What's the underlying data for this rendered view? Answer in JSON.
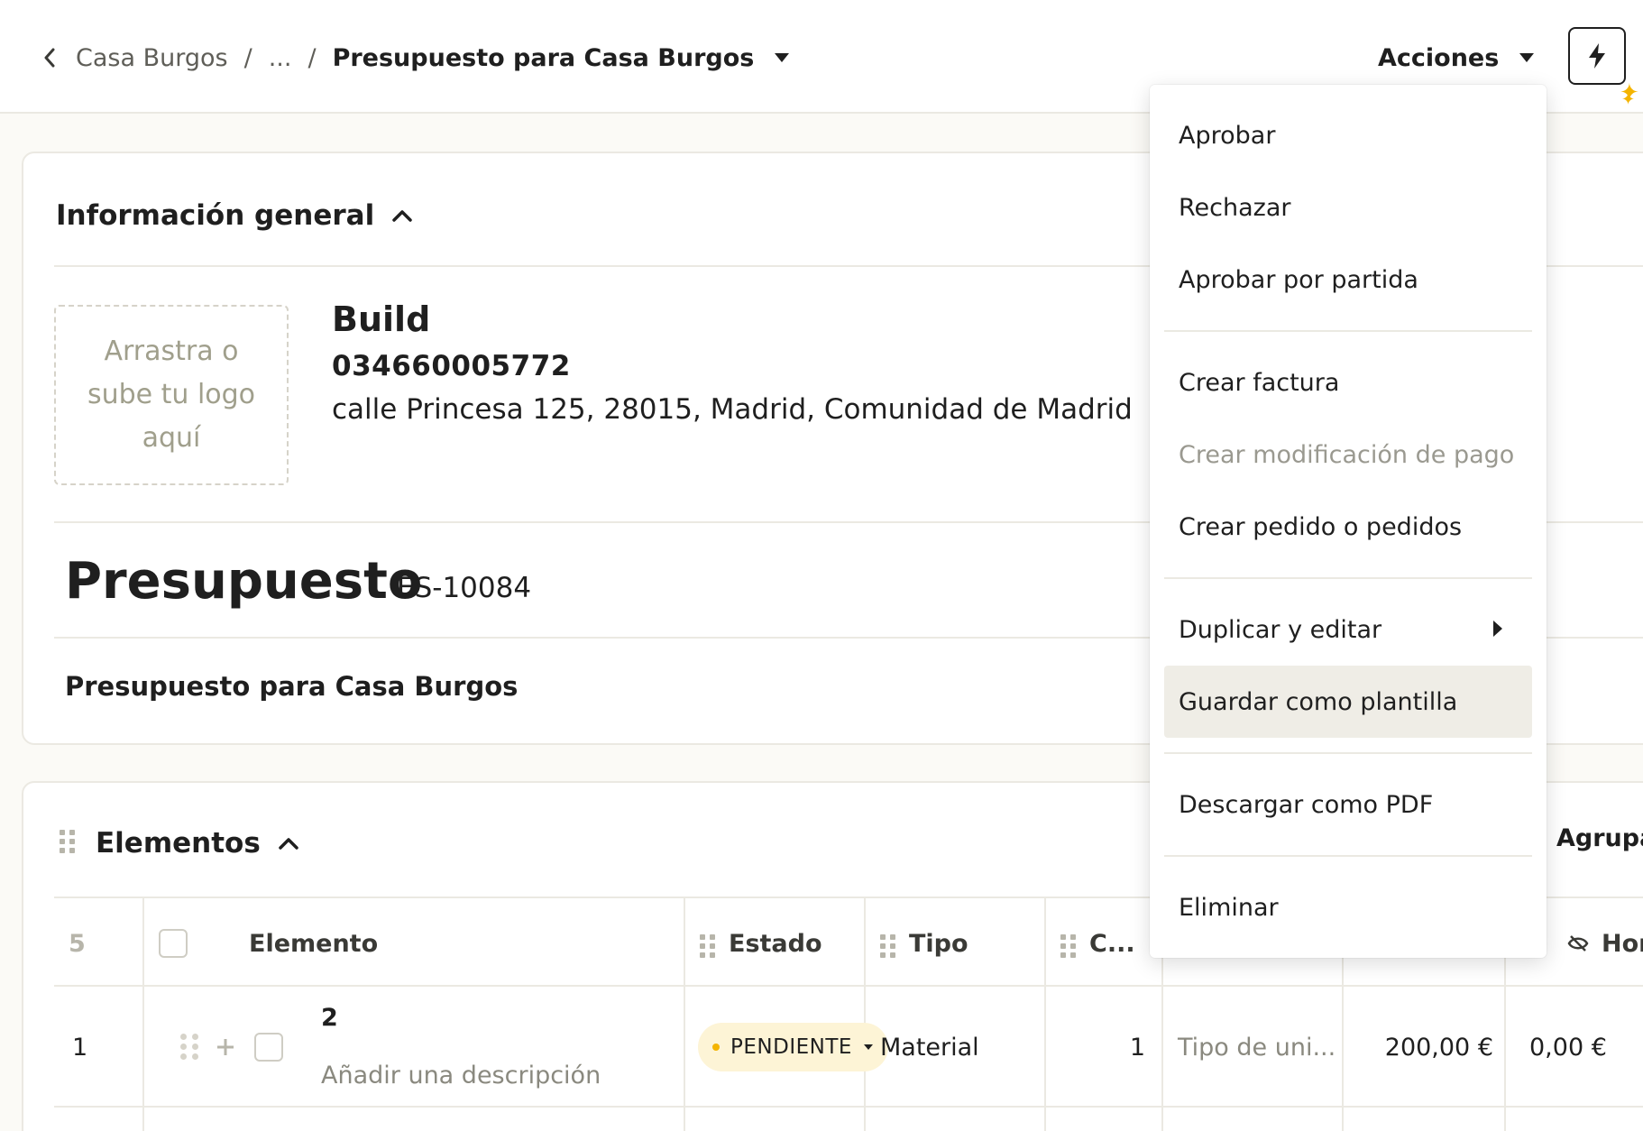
{
  "breadcrumb": {
    "parent": "Casa Burgos",
    "ellipsis": "...",
    "separator": "/",
    "current": "Presupuesto para Casa Burgos"
  },
  "header": {
    "actions_label": "Acciones"
  },
  "general": {
    "title": "Información general",
    "logo_placeholder": "Arrastra o sube tu logo aquí",
    "company_name": "Build",
    "company_phone": "034660005772",
    "company_address": "calle Princesa 125, 28015, Madrid, Comunidad de Madrid",
    "doc_type": "Presupuesto",
    "doc_number": "ES-10084",
    "doc_subject": "Presupuesto para Casa Burgos"
  },
  "items": {
    "title": "Elementos",
    "group_label": "Agrupa",
    "columns": {
      "count": "5",
      "element": "Elemento",
      "status": "Estado",
      "type": "Tipo",
      "quantity": "C...",
      "fee": "Hono"
    },
    "rows": [
      {
        "index": "1",
        "name": "2",
        "description_placeholder": "Añadir una descripción",
        "status": "PENDIENTE",
        "type": "Material",
        "quantity": "1",
        "unit_placeholder": "Tipo de uni...",
        "price": "200,00 €",
        "fee": "0,00 €"
      }
    ]
  },
  "actions_menu": {
    "items": [
      {
        "label": "Aprobar",
        "disabled": false
      },
      {
        "label": "Rechazar",
        "disabled": false
      },
      {
        "label": "Aprobar por partida",
        "disabled": false
      },
      {
        "label": "Crear factura",
        "disabled": false
      },
      {
        "label": "Crear modificación de pago",
        "disabled": true
      },
      {
        "label": "Crear pedido o pedidos",
        "disabled": false
      },
      {
        "label": "Duplicar y editar",
        "disabled": false,
        "submenu": true
      },
      {
        "label": "Guardar como plantilla",
        "disabled": false,
        "highlighted": true
      },
      {
        "label": "Descargar como PDF",
        "disabled": false
      },
      {
        "label": "Eliminar",
        "disabled": false
      }
    ]
  }
}
